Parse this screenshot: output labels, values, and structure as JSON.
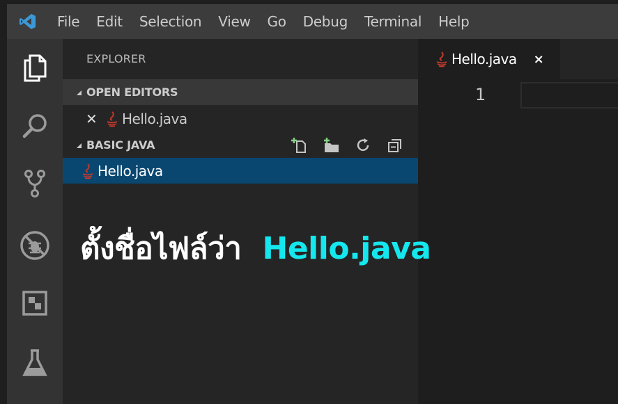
{
  "menu": {
    "items": [
      "File",
      "Edit",
      "Selection",
      "View",
      "Go",
      "Debug",
      "Terminal",
      "Help"
    ]
  },
  "activity_bar": {
    "icons": [
      "files-icon",
      "search-icon",
      "source-control-icon",
      "debug-icon",
      "extensions-icon",
      "test-flask-icon"
    ]
  },
  "sidebar": {
    "title": "EXPLORER",
    "open_editors": {
      "label": "OPEN EDITORS",
      "items": [
        {
          "name": "Hello.java"
        }
      ]
    },
    "folder": {
      "label": "BASIC JAVA",
      "actions": [
        "new-file-icon",
        "new-folder-icon",
        "refresh-icon",
        "collapse-all-icon"
      ],
      "items": [
        {
          "name": "Hello.java"
        }
      ]
    }
  },
  "editor": {
    "tab": {
      "label": "Hello.java",
      "close": "×"
    },
    "line_numbers": [
      "1"
    ]
  },
  "caption": {
    "thai_text": "ตั้งชื่อไฟล์ว่า",
    "filename": "Hello.java"
  },
  "colors": {
    "accent_caption": "#14e8ee",
    "selection": "#094771",
    "vscode_blue": "#3c99d8",
    "java_icon": "#c0392b"
  }
}
